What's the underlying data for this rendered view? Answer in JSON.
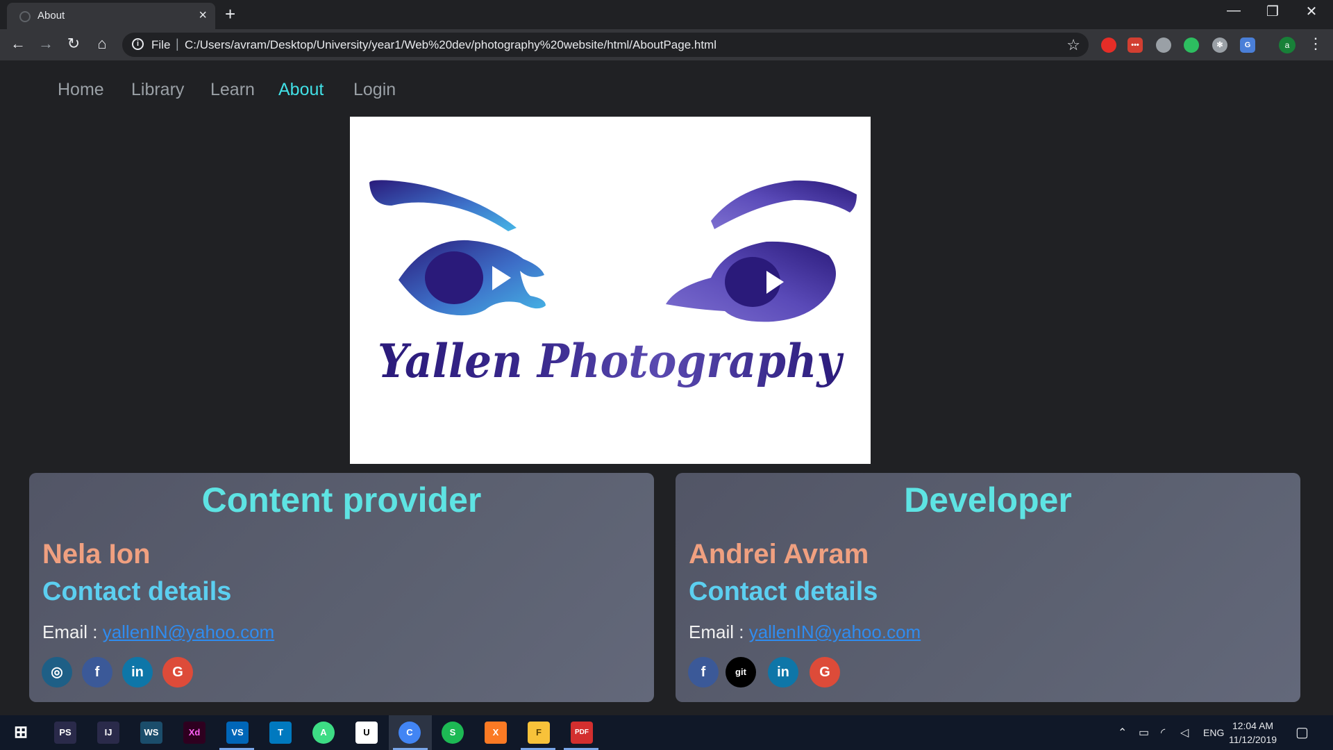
{
  "browser": {
    "tab_title": "About",
    "tab_close": "×",
    "new_tab": "+",
    "url_scheme": "File",
    "url_separator": "|",
    "url": "C:/Users/avram/Desktop/University/year1/Web%20dev/photography%20website/html/AboutPage.html",
    "profile_initial": "a",
    "window_controls": {
      "minimize": "—",
      "restore": "❐",
      "close": "✕"
    },
    "nav": {
      "back": "←",
      "forward": "→",
      "reload": "↻",
      "home": "⌂",
      "star": "☆",
      "menu": "⋮"
    }
  },
  "site_nav": {
    "items": [
      {
        "label": "Home"
      },
      {
        "label": "Library"
      },
      {
        "label": "Learn"
      },
      {
        "label": "About"
      },
      {
        "label": "Login"
      }
    ],
    "active": "About"
  },
  "logo": {
    "text": "Yallen Photography",
    "colors": {
      "deep": "#2a1a7a",
      "mid": "#4b3aa8",
      "light": "#46b6e6"
    }
  },
  "cards": [
    {
      "heading": "Content provider",
      "name": "Nela Ion",
      "contact_heading": "Contact details",
      "email_label": "Email : ",
      "email": "yallenIN@yahoo.com",
      "social": [
        {
          "icon": "instagram-icon",
          "glyph": "◎",
          "color": "#1e5f86"
        },
        {
          "icon": "facebook-icon",
          "glyph": "f",
          "color": "#3b5998"
        },
        {
          "icon": "linkedin-icon",
          "glyph": "in",
          "color": "#0e76a8"
        },
        {
          "icon": "google-icon",
          "glyph": "G",
          "color": "#dd4b39"
        }
      ]
    },
    {
      "heading": "Developer",
      "name": "Andrei Avram",
      "contact_heading": "Contact details",
      "email_label": "Email : ",
      "email": "yallenIN@yahoo.com",
      "social": [
        {
          "icon": "facebook-icon",
          "glyph": "f",
          "color": "#3b5998"
        },
        {
          "icon": "git-icon",
          "glyph": "git",
          "color": "#000000"
        },
        {
          "icon": "linkedin-icon",
          "glyph": "in",
          "color": "#0e76a8"
        },
        {
          "icon": "google-icon",
          "glyph": "G",
          "color": "#dd4b39"
        }
      ]
    }
  ],
  "taskbar": {
    "apps": [
      {
        "label": "PS",
        "color": "#2a2a4a"
      },
      {
        "label": "IJ",
        "color": "#2a2a4a"
      },
      {
        "label": "WS",
        "color": "#1b4d6b"
      },
      {
        "label": "Xd",
        "color": "#2e001f"
      },
      {
        "label": "VS",
        "color": "#0066b8"
      },
      {
        "label": "T",
        "color": "#0079bf"
      },
      {
        "label": "A",
        "color": "#3ddc84"
      },
      {
        "label": "U",
        "color": "#ffffff"
      },
      {
        "label": "C",
        "color": "#4285f4"
      },
      {
        "label": "S",
        "color": "#1db954"
      },
      {
        "label": "X",
        "color": "#fb7a24"
      },
      {
        "label": "F",
        "color": "#f8c23a"
      },
      {
        "label": "PDF",
        "color": "#d32f2f"
      }
    ],
    "language": "ENG",
    "time": "12:04 AM",
    "date": "11/12/2019"
  }
}
